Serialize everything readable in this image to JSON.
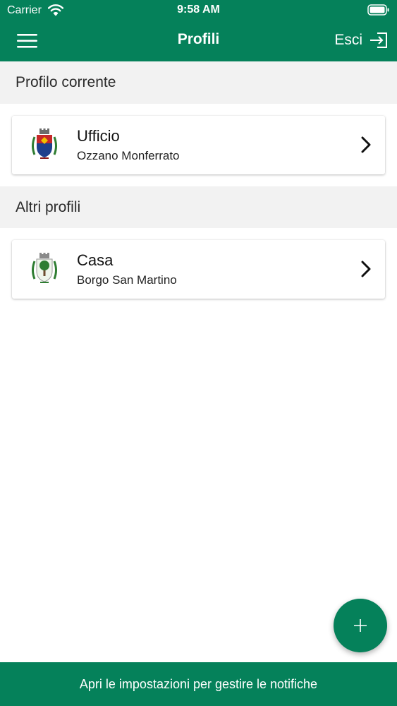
{
  "status_bar": {
    "carrier": "Carrier",
    "time": "9:58 AM"
  },
  "navbar": {
    "title": "Profili",
    "logout_label": "Esci"
  },
  "sections": {
    "current": {
      "header": "Profilo corrente",
      "profile": {
        "name": "Ufficio",
        "town": "Ozzano Monferrato",
        "crest_icon": "coat-of-arms-icon"
      }
    },
    "others": {
      "header": "Altri profili",
      "profiles": [
        {
          "name": "Casa",
          "town": "Borgo San Martino",
          "crest_icon": "coat-of-arms-icon"
        }
      ]
    }
  },
  "fab": {
    "icon": "plus-icon"
  },
  "bottom_bar": {
    "label": "Apri le impostazioni per gestire le notifiche"
  },
  "colors": {
    "primary": "#05815a",
    "section_bg": "#f2f2f2",
    "background": "#ffffff"
  }
}
